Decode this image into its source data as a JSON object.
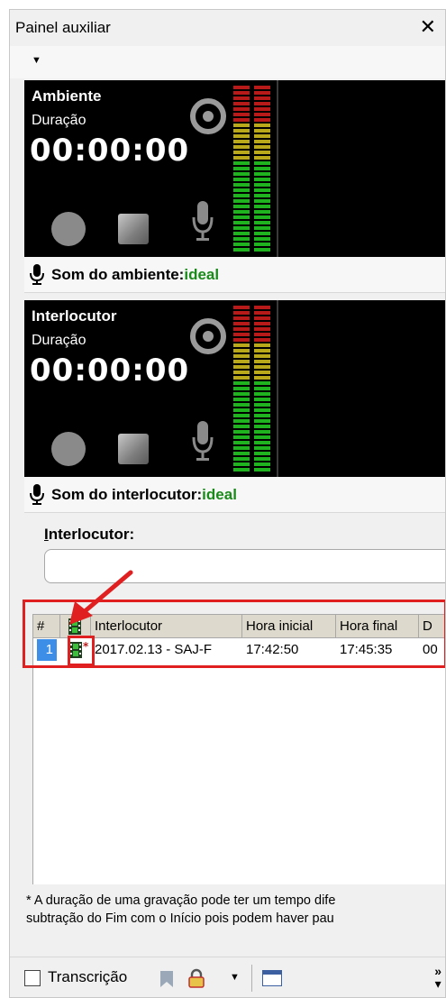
{
  "window": {
    "title": "Painel auxiliar",
    "close_glyph": "✕"
  },
  "toolstrip": {
    "dropdown_glyph": "▼"
  },
  "recorders": [
    {
      "title": "Ambiente",
      "duration_label": "Duração",
      "timer": "00:00:00",
      "status_label": "Som do ambiente:",
      "status_value": "ideal"
    },
    {
      "title": "Interlocutor",
      "duration_label": "Duração",
      "timer": "00:00:00",
      "status_label": "Som do interlocutor:",
      "status_value": "ideal"
    }
  ],
  "colors": {
    "status_ok": "#1a8a1a",
    "selection": "#3c8ee6",
    "highlight": "#e02020",
    "meter_green": "#1fb31f",
    "meter_yellow": "#b8a81a",
    "meter_red": "#b81a1a"
  },
  "interlocutor_field": {
    "label_first": "I",
    "label_rest": "nterlocutor:",
    "value": ""
  },
  "table": {
    "columns": [
      "#",
      "film-icon",
      "Interlocutor",
      "Hora inicial",
      "Hora final",
      "D"
    ],
    "rows": [
      {
        "num": "1",
        "interlocutor": "2017.02.13 - SAJ-F",
        "hora_inicial": "17:42:50",
        "hora_final": "17:45:35",
        "d": "00"
      }
    ]
  },
  "footnote": {
    "line1": "* A duração de uma gravação pode ter um tempo dife",
    "line2": "subtração do Fim com o Início pois podem haver pau"
  },
  "bottombar": {
    "transcricao_label": "Transcrição",
    "more_glyph": "»"
  }
}
